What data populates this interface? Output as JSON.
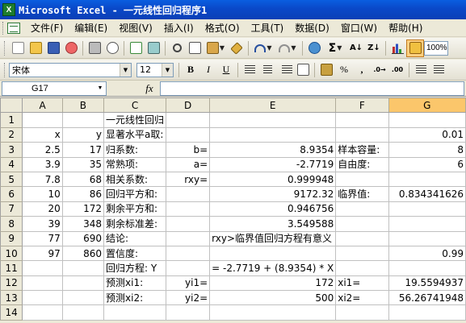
{
  "window": {
    "app_icon_glyph": "X",
    "title": "Microsoft Excel - 一元线性回归程序1"
  },
  "menu": [
    "文件(F)",
    "编辑(E)",
    "视图(V)",
    "插入(I)",
    "格式(O)",
    "工具(T)",
    "数据(D)",
    "窗口(W)",
    "帮助(H)"
  ],
  "toolbar": {
    "zoom": "100%",
    "sum_glyph": "Σ"
  },
  "format_toolbar": {
    "font": "宋体",
    "size": "12",
    "bold": "B",
    "italic": "I",
    "underline": "U",
    "percent": "%",
    "comma": ","
  },
  "formula_bar": {
    "name_box": "G17",
    "fx": "fx",
    "formula": ""
  },
  "columns": [
    "A",
    "B",
    "C",
    "D",
    "E",
    "F",
    "G"
  ],
  "selected_column": "G",
  "rows": [
    {
      "n": "1",
      "A": "",
      "B": "",
      "C": "一元线性回归",
      "D": "",
      "E": "",
      "F": "",
      "G": ""
    },
    {
      "n": "2",
      "A": "x",
      "B": "y",
      "C": "显著水平a取:",
      "D": "",
      "E": "",
      "F": "",
      "G": "0.01"
    },
    {
      "n": "3",
      "A": "2.5",
      "B": "17",
      "C": "归系数:",
      "D": "b=",
      "E": "8.9354",
      "F": "样本容量:",
      "G": "8"
    },
    {
      "n": "4",
      "A": "3.9",
      "B": "35",
      "C": "常熟项:",
      "D": "a=",
      "E": "-2.7719",
      "F": "自由度:",
      "G": "6"
    },
    {
      "n": "5",
      "A": "7.8",
      "B": "68",
      "C": "相关系数:",
      "D": "rxy=",
      "E": "0.999948",
      "F": "",
      "G": ""
    },
    {
      "n": "6",
      "A": "10",
      "B": "86",
      "C": "回归平方和:",
      "D": "",
      "E": "9172.32",
      "F": "临界值:",
      "G": "0.834341626"
    },
    {
      "n": "7",
      "A": "20",
      "B": "172",
      "C": "剩余平方和:",
      "D": "",
      "E": "0.946756",
      "F": "",
      "G": ""
    },
    {
      "n": "8",
      "A": "39",
      "B": "348",
      "C": "剩余标准差:",
      "D": "",
      "E": "3.549588",
      "F": "",
      "G": ""
    },
    {
      "n": "9",
      "A": "77",
      "B": "690",
      "C": "结论:",
      "D": "",
      "E": "rxy>临界值回归方程有意义",
      "F": "",
      "G": ""
    },
    {
      "n": "10",
      "A": "97",
      "B": "860",
      "C": "置信度:",
      "D": "",
      "E": "",
      "F": "",
      "G": "0.99"
    },
    {
      "n": "11",
      "A": "",
      "B": "",
      "C": "回归方程: Y",
      "D": "",
      "E": "=   -2.7719  +   (8.9354) * X",
      "F": "",
      "G": ""
    },
    {
      "n": "12",
      "A": "",
      "B": "",
      "C": "预测xi1:",
      "D": "yi1=",
      "E": "172",
      "F": "xi1=",
      "G": "19.5594937"
    },
    {
      "n": "13",
      "A": "",
      "B": "",
      "C": "预测xi2:",
      "D": "yi2=",
      "E": "500",
      "F": "xi2=",
      "G": "56.26741948"
    },
    {
      "n": "14",
      "A": "",
      "B": "",
      "C": "",
      "D": "",
      "E": "",
      "F": "",
      "G": ""
    }
  ]
}
